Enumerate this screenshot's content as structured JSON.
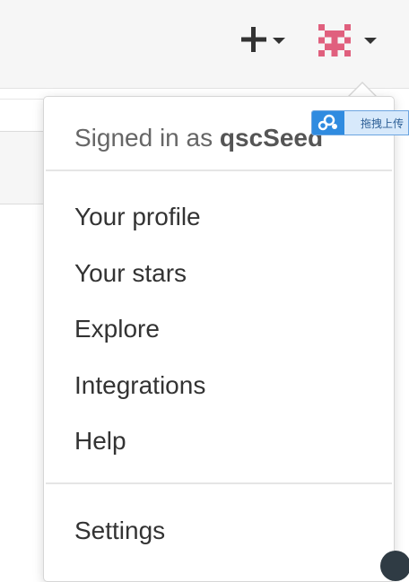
{
  "header": {
    "create_icon": "plus-icon",
    "create_caret_icon": "caret-down-icon",
    "avatar_icon": "identicon-avatar",
    "avatar_color": "#e0607e",
    "avatar_caret_icon": "caret-down-icon"
  },
  "dropdown": {
    "signed_in_prefix": "Signed in as",
    "username": "qscSeed",
    "items": [
      {
        "label": "Your profile"
      },
      {
        "label": "Your stars"
      },
      {
        "label": "Explore"
      },
      {
        "label": "Integrations"
      },
      {
        "label": "Help"
      }
    ],
    "settings_label": "Settings"
  },
  "overlay": {
    "upload_label": "拖拽上传",
    "icon": "cloud-icon",
    "accent": "#2f8be0"
  }
}
